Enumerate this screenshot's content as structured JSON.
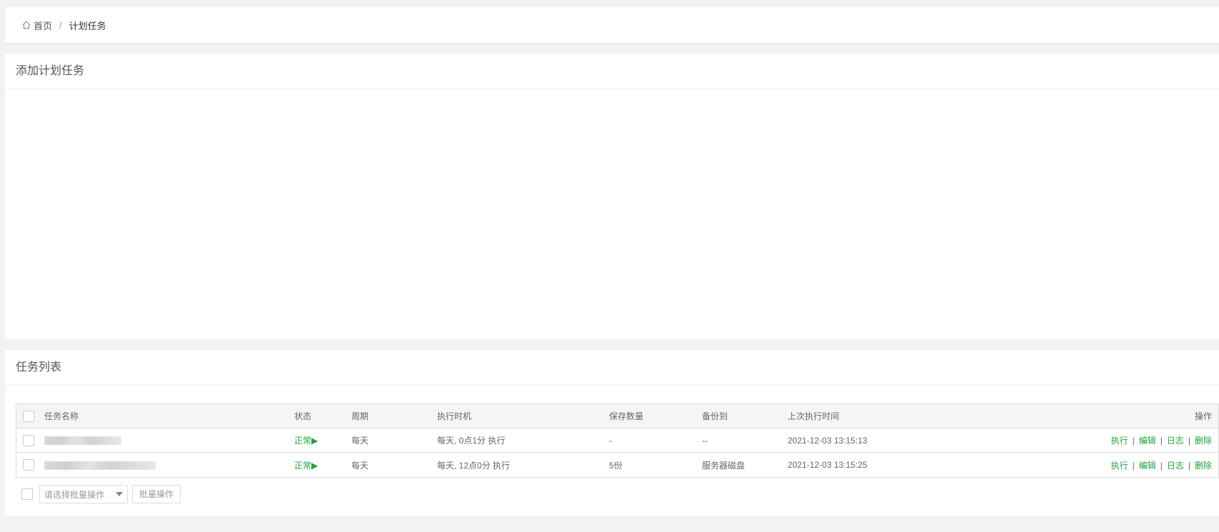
{
  "breadcrumb": {
    "home_label": "首页",
    "separator": "/",
    "current": "计划任务"
  },
  "add_panel": {
    "title": "添加计划任务"
  },
  "list_panel": {
    "title": "任务列表",
    "columns": [
      "任务名称",
      "状态",
      "周期",
      "执行时机",
      "保存数量",
      "备份到",
      "上次执行时间",
      "操作"
    ],
    "rows": [
      {
        "status": "正常▶",
        "cycle": "每天",
        "timing": "每天, 0点1分 执行",
        "keep": "-",
        "backup_to": "--",
        "last_run": "2021-12-03 13:15:13"
      },
      {
        "status": "正常▶",
        "cycle": "每天",
        "timing": "每天, 12点0分 执行",
        "keep": "5份",
        "backup_to": "服务器磁盘",
        "last_run": "2021-12-03 13:15:25"
      }
    ],
    "operations": [
      "执行",
      "编辑",
      "日志",
      "删除"
    ],
    "op_separator": "|",
    "batch_select_placeholder": "请选择批量操作",
    "batch_button": "批量操作"
  },
  "colors": {
    "accent_green": "#20a53a",
    "page_bg": "#f2f2f2"
  },
  "icons": {
    "home": "home-icon",
    "status_play": "play-icon",
    "dropdown": "chevron-down-icon"
  }
}
